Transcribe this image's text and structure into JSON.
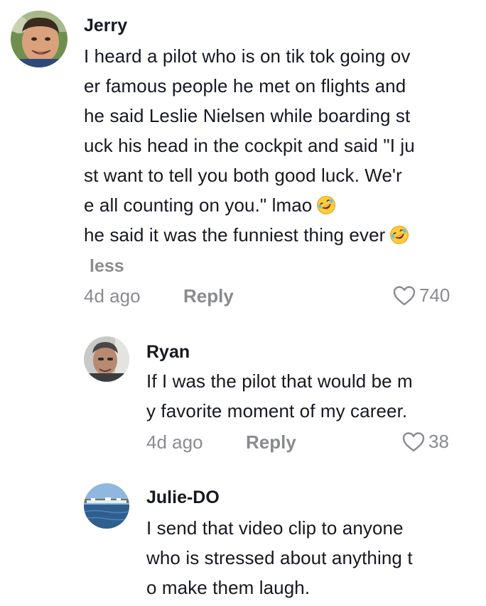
{
  "comments": [
    {
      "username": "Jerry",
      "lines": [
        "I heard a pilot who is on tik tok going ov",
        "er famous people he met on flights and",
        "he said Leslie Nielsen while boarding st",
        "uck his head in the cockpit and said \"I ju",
        "st want to tell you both good luck. We'r",
        "e all counting on you.\"  lmao",
        "he said it was the funniest thing ever"
      ],
      "emoji": "rolling-on-floor-laughing-emoji",
      "less_label": "less",
      "time": "4d ago",
      "reply_label": "Reply",
      "likes": "740"
    },
    {
      "username": "Ryan",
      "lines": [
        "If I was the pilot that would be m",
        "y favorite moment of my career."
      ],
      "time": "4d ago",
      "reply_label": "Reply",
      "likes": "38"
    },
    {
      "username": "Julie-DO",
      "lines": [
        "I send that video clip to anyone",
        "who is stressed about anything t",
        "o make them laugh."
      ]
    }
  ],
  "colors": {
    "primary_text": "#161823",
    "secondary_text": "#8a8b91"
  }
}
